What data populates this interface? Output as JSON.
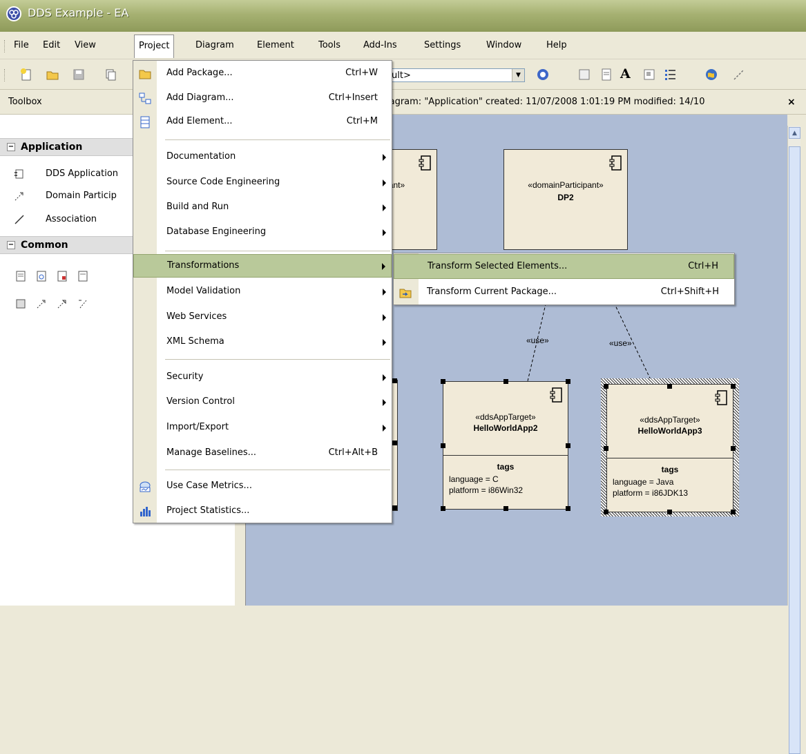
{
  "window": {
    "title": "DDS Example - EA"
  },
  "menubar": {
    "items": [
      "File",
      "Edit",
      "View",
      "Project",
      "Diagram",
      "Element",
      "Tools",
      "Add-Ins",
      "Settings",
      "Window",
      "Help"
    ],
    "open_item": "Project"
  },
  "toolbar": {
    "combo_value": "ult>"
  },
  "toolbox": {
    "title": "Toolbox",
    "sections": [
      {
        "name": "Application",
        "items": [
          "DDS Application",
          "Domain Particip",
          "Association"
        ]
      },
      {
        "name": "Common"
      }
    ]
  },
  "diagram": {
    "info": "iagram: \"Application\"  created: 11/07/2008 1:01:19 PM  modified: 14/10",
    "close_glyph": "×",
    "use_label": "«use»",
    "participant_stub": {
      "stereotype": "ant»"
    },
    "dp2": {
      "stereotype": "«domainParticipant»",
      "name": "DP2"
    },
    "apps": [
      {
        "stereotype": "«ddsAppTarget»",
        "name": "HelloWorldApp2",
        "tags_title": "tags",
        "tags": [
          "language = C",
          "platform = i86Win32"
        ]
      },
      {
        "stereotype": "«ddsAppTarget»",
        "name": "HelloWorldApp3",
        "tags_title": "tags",
        "tags": [
          "language = Java",
          "platform = i86JDK13"
        ]
      }
    ]
  },
  "project_menu": {
    "items": [
      {
        "label": "Add Package...",
        "shortcut": "Ctrl+W",
        "icon": "folder-icon"
      },
      {
        "label": "Add Diagram...",
        "shortcut": "Ctrl+Insert",
        "icon": "diagram-icon"
      },
      {
        "label": "Add Element...",
        "shortcut": "Ctrl+M",
        "icon": "element-icon"
      },
      {
        "label": "Documentation",
        "submenu": true
      },
      {
        "label": "Source Code Engineering",
        "submenu": true
      },
      {
        "label": "Build and Run",
        "submenu": true
      },
      {
        "label": "Database Engineering",
        "submenu": true
      },
      {
        "label": "Transformations",
        "submenu": true,
        "highlighted": true
      },
      {
        "label": "Model Validation",
        "submenu": true
      },
      {
        "label": "Web Services",
        "submenu": true
      },
      {
        "label": "XML Schema",
        "submenu": true
      },
      {
        "label": "Security",
        "submenu": true
      },
      {
        "label": "Version Control",
        "submenu": true
      },
      {
        "label": "Import/Export",
        "submenu": true
      },
      {
        "label": "Manage Baselines...",
        "shortcut": "Ctrl+Alt+B"
      },
      {
        "label": "Use Case Metrics...",
        "icon": "metrics-icon"
      },
      {
        "label": "Project Statistics...",
        "icon": "statistics-icon"
      }
    ]
  },
  "transform_submenu": {
    "items": [
      {
        "label": "Transform Selected Elements...",
        "shortcut": "Ctrl+H",
        "highlighted": true
      },
      {
        "label": "Transform Current Package...",
        "shortcut": "Ctrl+Shift+H",
        "icon": "transform-package-icon"
      }
    ]
  }
}
